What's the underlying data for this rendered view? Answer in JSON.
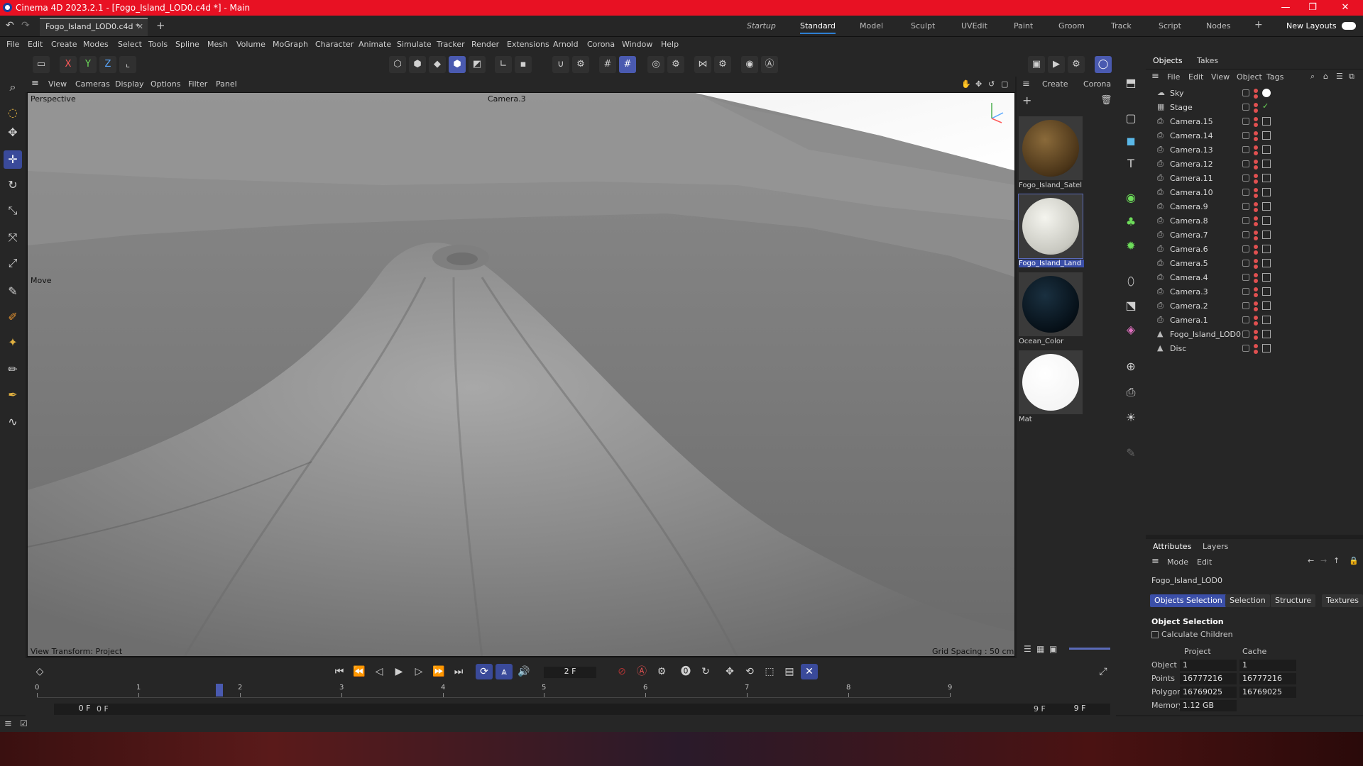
{
  "window": {
    "title": "Cinema 4D 2023.2.1 - [Fogo_Island_LOD0.c4d *] - Main",
    "controls": [
      "—",
      "❐",
      "✕"
    ]
  },
  "tabs": {
    "doc_tab": "Fogo_Island_LOD0.c4d *",
    "add": "+",
    "layouts": [
      "Startup",
      "Standard",
      "Model",
      "Sculpt",
      "UVEdit",
      "Paint",
      "Groom",
      "Track",
      "Script",
      "Nodes"
    ],
    "active_layout": "Standard",
    "new_layouts": "New Layouts"
  },
  "menu": [
    "File",
    "Edit",
    "Create",
    "Modes",
    "Select",
    "Tools",
    "Spline",
    "Mesh",
    "Volume",
    "MoGraph",
    "Character",
    "Animate",
    "Simulate",
    "Tracker",
    "Render",
    "Extensions",
    "Arnold",
    "Corona",
    "Window",
    "Help"
  ],
  "toolbar": {
    "axes": [
      "X",
      "Y",
      "Z"
    ]
  },
  "viewport": {
    "menu": [
      "View",
      "Cameras",
      "Display",
      "Options",
      "Filter",
      "Panel"
    ],
    "label_perspective": "Perspective",
    "label_camera": "Camera.3",
    "label_move": "Move",
    "label_transform": "View Transform: Project",
    "label_grid": "Grid Spacing : 50 cm"
  },
  "materials": {
    "menu": [
      "Create",
      "Corona"
    ],
    "items": [
      {
        "name": "Fogo_Island_Satel",
        "color": "#6b5230"
      },
      {
        "name": "Fogo_Island_Land",
        "color": "#d8d8d0"
      },
      {
        "name": "Ocean_Color",
        "color": "#0a1a2a"
      },
      {
        "name": "Mat",
        "color": "#ffffff"
      }
    ]
  },
  "objects": {
    "tabs": [
      "Objects",
      "Takes"
    ],
    "menu": [
      "File",
      "Edit",
      "View",
      "Object",
      "Tags"
    ],
    "items": [
      "Sky",
      "Stage",
      "Camera.15",
      "Camera.14",
      "Camera.13",
      "Camera.12",
      "Camera.11",
      "Camera.10",
      "Camera.9",
      "Camera.8",
      "Camera.7",
      "Camera.6",
      "Camera.5",
      "Camera.4",
      "Camera.3",
      "Camera.2",
      "Camera.1",
      "Fogo_Island_LOD0",
      "Disc"
    ]
  },
  "attributes": {
    "tabs": [
      "Attributes",
      "Layers"
    ],
    "menu": [
      "Mode",
      "Edit"
    ],
    "object_name": "Fogo_Island_LOD0",
    "buttons": [
      "Objects Selection",
      "Selection",
      "Structure",
      "Textures"
    ],
    "section": "Object Selection",
    "calc_children": "Calculate Children",
    "col_project": "Project",
    "col_cache": "Cache",
    "rows": [
      {
        "label": "Object",
        "project": "1",
        "cache": "1"
      },
      {
        "label": "Points",
        "project": "16777216",
        "cache": "16777216"
      },
      {
        "label": "Polygons",
        "project": "16769025",
        "cache": "16769025"
      },
      {
        "label": "Memory",
        "project": "1.12 GB",
        "cache": ""
      }
    ]
  },
  "timeline": {
    "current_frame": "2 F",
    "ticks": [
      "0",
      "1",
      "2",
      "3",
      "4",
      "5",
      "6",
      "7",
      "8",
      "9"
    ],
    "start": "0 F",
    "start2": "0 F",
    "end": "9 F",
    "end2": "9 F",
    "progress": 0.2
  }
}
